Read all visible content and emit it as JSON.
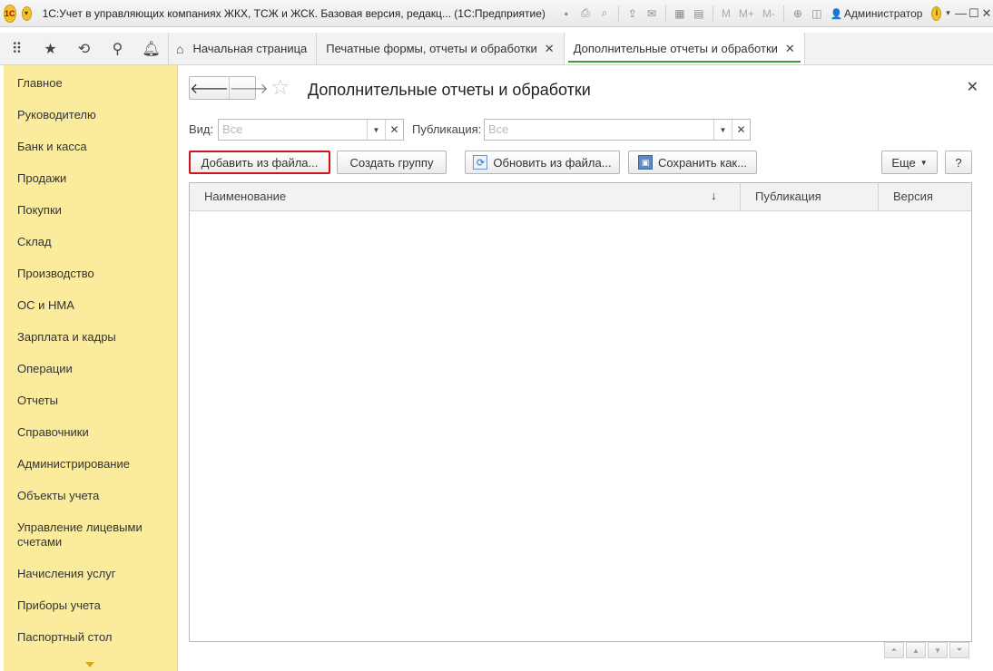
{
  "window": {
    "logo": "1С",
    "title": "1С:Учет в управляющих компаниях ЖКХ, ТСЖ и ЖСК. Базовая версия, редакц... (1С:Предприятие)",
    "memory_buttons": [
      "M",
      "M+",
      "M-"
    ],
    "user": "Администратор"
  },
  "nav": {
    "tabs": [
      {
        "label": "Начальная страница"
      },
      {
        "label": "Печатные формы, отчеты и обработки"
      },
      {
        "label": "Дополнительные отчеты и обработки"
      }
    ]
  },
  "sidebar": {
    "items": [
      {
        "label": "Главное"
      },
      {
        "label": "Руководителю"
      },
      {
        "label": "Банк и касса"
      },
      {
        "label": "Продажи"
      },
      {
        "label": "Покупки"
      },
      {
        "label": "Склад"
      },
      {
        "label": "Производство"
      },
      {
        "label": "ОС и НМА"
      },
      {
        "label": "Зарплата и кадры"
      },
      {
        "label": "Операции"
      },
      {
        "label": "Отчеты"
      },
      {
        "label": "Справочники"
      },
      {
        "label": "Администрирование"
      },
      {
        "label": "Объекты учета"
      },
      {
        "label": "Управление лицевыми счетами"
      },
      {
        "label": "Начисления услуг"
      },
      {
        "label": "Приборы учета"
      },
      {
        "label": "Паспортный стол"
      }
    ]
  },
  "page": {
    "title": "Дополнительные отчеты и обработки",
    "filters": {
      "kind_label": "Вид:",
      "kind_placeholder": "Все",
      "publication_label": "Публикация:",
      "publication_placeholder": "Все"
    },
    "buttons": {
      "add_from_file": "Добавить из файла...",
      "create_group": "Создать группу",
      "update_from_file": "Обновить из файла...",
      "save_as": "Сохранить как...",
      "more": "Еще",
      "help": "?"
    },
    "table": {
      "columns": [
        "Наименование",
        "Публикация",
        "Версия"
      ],
      "sort_indicator": "↓",
      "rows": []
    }
  },
  "colors": {
    "sidebar_bg": "#fbeb9d",
    "active_tab_underline": "#3c9b3c",
    "highlight_border": "#d0121b"
  }
}
